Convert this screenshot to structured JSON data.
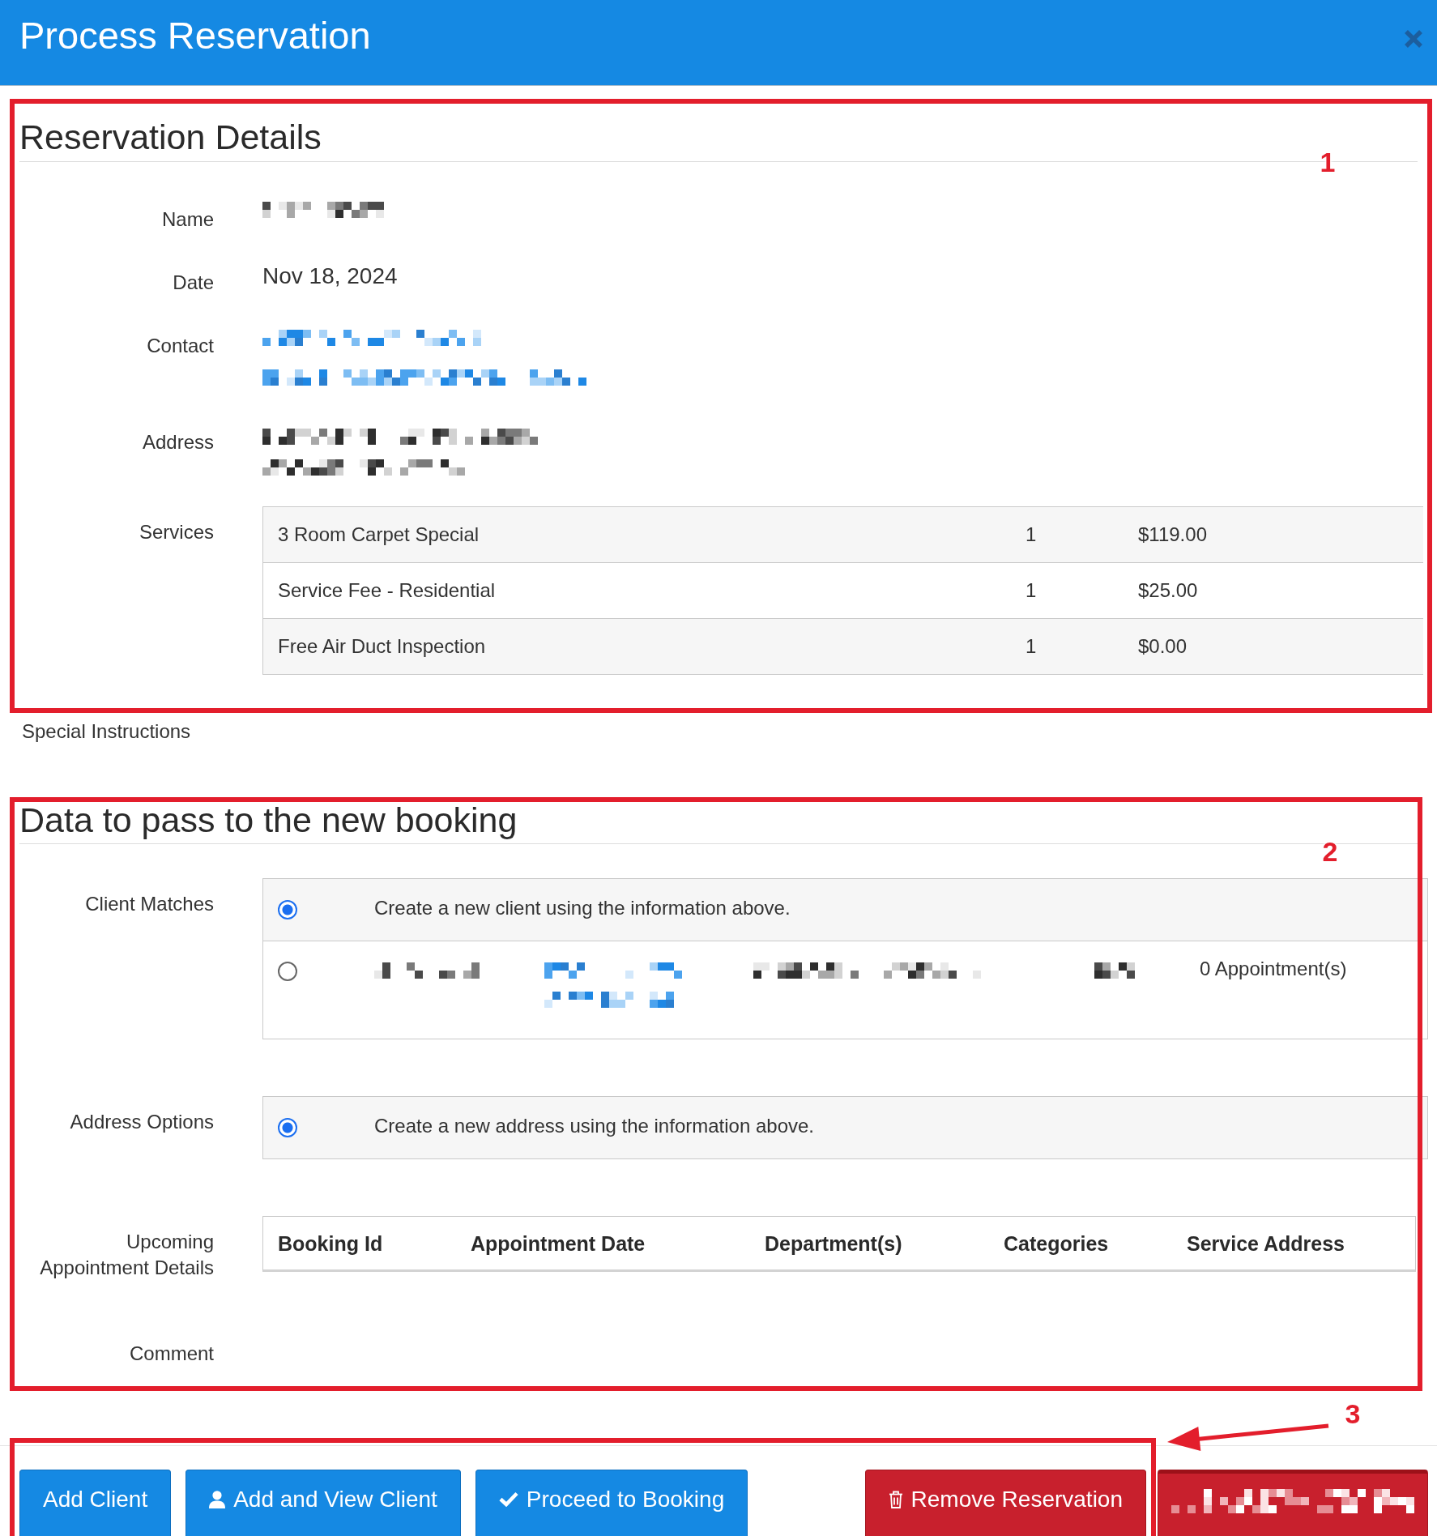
{
  "dialog": {
    "title": "Process Reservation"
  },
  "reservation_details": {
    "heading": "Reservation Details",
    "fields": [
      {
        "label": "Name",
        "kind": "lines",
        "values": [
          {
            "kind": "redacted"
          }
        ]
      },
      {
        "label": "Date",
        "kind": "lines",
        "values": [
          {
            "kind": "text",
            "text": "Nov 18, 2024"
          }
        ]
      },
      {
        "label": "Contact",
        "kind": "lines",
        "values": [
          {
            "kind": "redactedlink"
          },
          {
            "kind": "redactedlink"
          }
        ]
      },
      {
        "label": "Address",
        "kind": "lines",
        "values": [
          {
            "kind": "redacted"
          },
          {
            "kind": "redacted"
          }
        ]
      },
      {
        "label": "Services",
        "kind": "table",
        "rows": [
          {
            "service": "3 Room Carpet Special",
            "quantity": "1",
            "price": "$119.00"
          },
          {
            "service": "Service Fee - Residential",
            "quantity": "1",
            "price": "$25.00"
          },
          {
            "service": "Free Air Duct Inspection",
            "quantity": "1",
            "price": "$0.00"
          }
        ]
      }
    ]
  },
  "special_instructions": {
    "label": "Special Instructions"
  },
  "booking_data": {
    "heading": "Data to pass to the new booking",
    "fields": [
      {
        "label": "Client Matches",
        "kind": "options",
        "options": [
          {
            "kind": "new",
            "selected": true,
            "text": "Create a new client using the information above."
          },
          {
            "kind": "existing",
            "selected": false,
            "fields": [
              {
                "lines": [
                  {
                    "kind": "redacted"
                  }
                ]
              },
              {
                "lines": [
                  {
                    "kind": "redactedlink"
                  },
                  {
                    "kind": "redactedlink"
                  }
                ]
              },
              {
                "lines": [
                  {
                    "kind": "redacted"
                  }
                ]
              },
              {
                "lines": [
                  {
                    "kind": "redacted"
                  }
                ]
              },
              {
                "lines": [
                  {
                    "kind": "redacted"
                  }
                ]
              }
            ],
            "appointments": "0 Appointment(s)"
          }
        ]
      },
      {
        "label": "Address Options",
        "kind": "options",
        "options": [
          {
            "kind": "new",
            "selected": true,
            "text": "Create a new address using the information above."
          }
        ]
      },
      {
        "label": "Upcoming Appointment Details",
        "kind": "columns",
        "columns": [
          "Booking Id",
          "Appointment Date",
          "Department(s)",
          "Categories",
          "Service Address"
        ]
      },
      {
        "label": "Comment",
        "kind": "empty"
      }
    ]
  },
  "footer": {
    "buttons": [
      {
        "kind": "primary",
        "label": "Add Client"
      },
      {
        "kind": "primary",
        "label": "Add and View Client"
      },
      {
        "kind": "primary",
        "label": "Proceed to Booking"
      },
      {
        "kind": "danger",
        "label": "Remove Reservation"
      },
      {
        "kind": "masked"
      }
    ]
  },
  "annotations": [
    {
      "number": "1",
      "arrow": false
    },
    {
      "number": "2",
      "arrow": false
    },
    {
      "number": "3",
      "arrow": true
    }
  ]
}
